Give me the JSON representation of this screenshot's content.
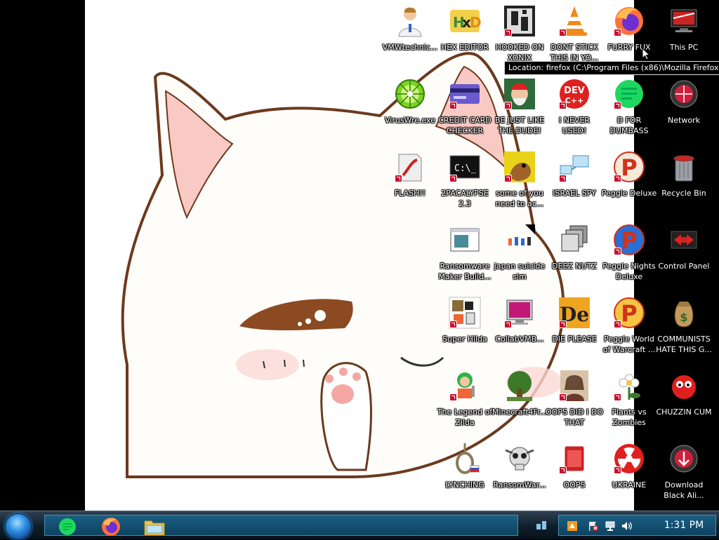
{
  "desktop": {
    "icons": [
      {
        "label": "VMWtechnic...",
        "icon": "doctor-user-icon"
      },
      {
        "label": "HEX EDITOR",
        "icon": "hex-editor-icon"
      },
      {
        "label": "HOOKED ON XONIX",
        "icon": "xonix-game-icon"
      },
      {
        "label": "DONT STICK THIS IN YO...",
        "icon": "vlc-cone-icon"
      },
      {
        "label": "FURRY FUX",
        "icon": "firefox-icon"
      },
      {
        "label": "This PC",
        "icon": "this-pc-icon"
      },
      {
        "label": "VirusWre.exe",
        "icon": "lime-disc-icon"
      },
      {
        "label": "CREDIT CARD CHECKER",
        "icon": "credit-card-icon"
      },
      {
        "label": "BE JUST LIKE THE DUDE!",
        "icon": "santa-face-icon"
      },
      {
        "label": "I NEVER USED!",
        "icon": "devcpp-icon"
      },
      {
        "label": "D FOR DUMBASS",
        "icon": "green-notepad-icon"
      },
      {
        "label": "Network",
        "icon": "network-orb-icon"
      },
      {
        "label": "FLASH!!",
        "icon": "flash-icon"
      },
      {
        "label": "2PACALYPSE 2.3",
        "icon": "terminal-icon"
      },
      {
        "label": "some of you need to ac...",
        "icon": "scooby-icon"
      },
      {
        "label": "ISRAEL SPY",
        "icon": "spy-network-icon"
      },
      {
        "label": "Peggle Deluxe",
        "icon": "peggle-icon"
      },
      {
        "label": "Recycle Bin",
        "icon": "recycle-bin-icon"
      },
      {
        "label": "Ransomware Maker Build...",
        "icon": "app-window-icon"
      },
      {
        "label": "japan suicide sim",
        "icon": "tiny-figures-icon"
      },
      {
        "label": "DEEZ NUTZ",
        "icon": "stacked-windows-icon"
      },
      {
        "label": "Peggle Nights Deluxe",
        "icon": "peggle-nights-icon"
      },
      {
        "label": "Control Panel",
        "icon": "control-panel-icon"
      },
      {
        "label": "Super Hilda",
        "icon": "pixel-character-icon"
      },
      {
        "label": "CollabVMB...",
        "icon": "monitor-icon"
      },
      {
        "label": "DIE PLEASE",
        "icon": "de-logo-icon"
      },
      {
        "label": "Peggle World of Warcraft ...",
        "icon": "peggle-wow-icon"
      },
      {
        "label": "COMMUNISTS HATE THIS G...",
        "icon": "money-bag-icon"
      },
      {
        "label": "The Legend of Zilda",
        "icon": "zilda-character-icon"
      },
      {
        "label": "Minecraft4Fr...",
        "icon": "minecraft-tree-icon"
      },
      {
        "label": "OOPS DID I DO THAT",
        "icon": "portrait-icon"
      },
      {
        "label": "Plants vs Zombies",
        "icon": "flower-icon"
      },
      {
        "label": "CHUZZIN CUM",
        "icon": "red-chuzzle-icon"
      },
      {
        "label": "LYNCHING",
        "icon": "noose-icon"
      },
      {
        "label": "RansomWar...",
        "icon": "skull-icon"
      },
      {
        "label": "OOPS",
        "icon": "red-app-icon"
      },
      {
        "label": "UKRAINE",
        "icon": "radiation-icon"
      },
      {
        "label": "Download Black Ali...",
        "icon": "download-orb-icon"
      }
    ]
  },
  "tooltip": {
    "text": "Location: firefox (C:\\Program Files (x86)\\Mozilla Firefox)"
  },
  "taskbar": {
    "start_icon": "start-orb-icon",
    "pinned": [
      {
        "name": "notepad",
        "icon": "green-notepad-icon"
      },
      {
        "name": "firefox",
        "icon": "firefox-icon"
      },
      {
        "name": "explorer",
        "icon": "folder-icon"
      }
    ],
    "tray_icons": [
      "app-tray-icon",
      "flag-error-icon",
      "network-tray-icon",
      "volume-icon"
    ],
    "clock": "1:31 PM"
  },
  "colors": {
    "taskbar_top": "#2e4152",
    "taskbar_bottom": "#07121a",
    "task_area": "#1a5f82",
    "shortcut_badge": "#c8102e"
  }
}
